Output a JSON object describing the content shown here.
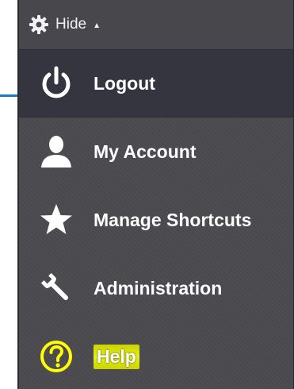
{
  "header": {
    "label": "Hide",
    "caret": "▲",
    "icon": "gear-icon"
  },
  "menu": {
    "items": [
      {
        "label": "Logout",
        "icon": "power-icon",
        "active": true
      },
      {
        "label": "My Account",
        "icon": "user-icon",
        "active": false
      },
      {
        "label": "Manage Shortcuts",
        "icon": "star-icon",
        "active": false
      },
      {
        "label": "Administration",
        "icon": "wrench-icon",
        "active": false
      },
      {
        "label": "Help",
        "icon": "help-icon",
        "active": false,
        "highlighted": true
      }
    ]
  },
  "colors": {
    "panel_bg": "#4a4a4f",
    "active_bg": "#34353e",
    "callout_line": "#1f78c8",
    "help_highlight": "#d8e600",
    "help_icon": "#ffff00"
  }
}
